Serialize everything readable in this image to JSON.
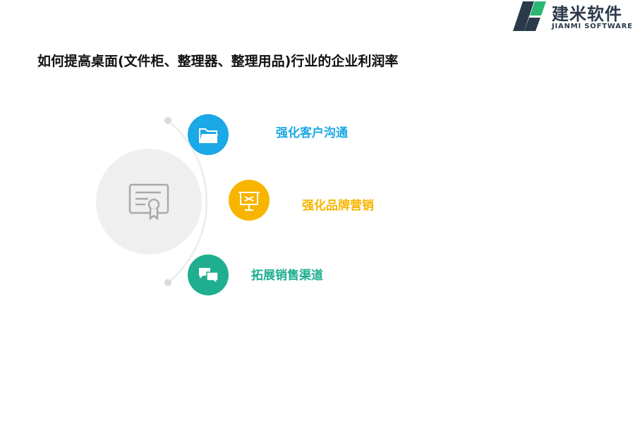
{
  "brand": {
    "name": "建米软件",
    "subtitle": "JIANMI SOFTWARE",
    "colors": {
      "dark": "#2b3a4a",
      "green": "#2bb673"
    }
  },
  "page": {
    "title": "如何提高桌面(文件柜、整理器、整理用品)行业的企业利润率"
  },
  "diagram": {
    "center_icon": "certificate-icon",
    "items": [
      {
        "label": "强化客户沟通",
        "icon": "folder-icon",
        "color": "#1aa8e6"
      },
      {
        "label": "强化品牌营销",
        "icon": "presentation-board-icon",
        "color": "#f7b500"
      },
      {
        "label": "拓展销售渠道",
        "icon": "chat-bubbles-icon",
        "color": "#1fae8f"
      }
    ]
  }
}
